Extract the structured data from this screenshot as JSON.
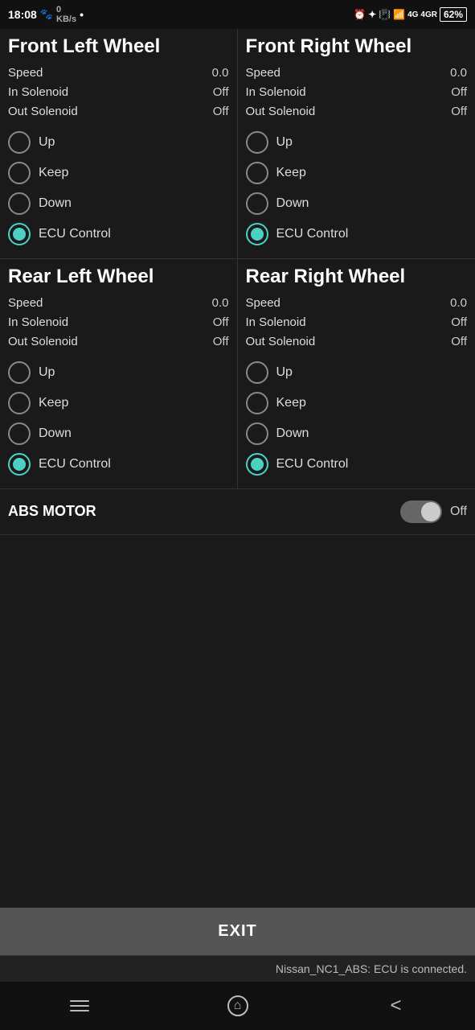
{
  "statusBar": {
    "time": "18:08",
    "battery": "62"
  },
  "wheels": [
    {
      "id": "front-left",
      "title": "Front Left Wheel",
      "speed_label": "Speed",
      "speed_value": "0.0",
      "in_solenoid_label": "In Solenoid",
      "in_solenoid_value": "Off",
      "out_solenoid_label": "Out Solenoid",
      "out_solenoid_value": "Off",
      "options": [
        "Up",
        "Keep",
        "Down",
        "ECU Control"
      ],
      "selected": 3
    },
    {
      "id": "front-right",
      "title": "Front Right Wheel",
      "speed_label": "Speed",
      "speed_value": "0.0",
      "in_solenoid_label": "In Solenoid",
      "in_solenoid_value": "Off",
      "out_solenoid_label": "Out Solenoid",
      "out_solenoid_value": "Off",
      "options": [
        "Up",
        "Keep",
        "Down",
        "ECU Control"
      ],
      "selected": 3
    },
    {
      "id": "rear-left",
      "title": "Rear Left Wheel",
      "speed_label": "Speed",
      "speed_value": "0.0",
      "in_solenoid_label": "In Solenoid",
      "in_solenoid_value": "Off",
      "out_solenoid_label": "Out Solenoid",
      "out_solenoid_value": "Off",
      "options": [
        "Up",
        "Keep",
        "Down",
        "ECU Control"
      ],
      "selected": 3
    },
    {
      "id": "rear-right",
      "title": "Rear Right Wheel",
      "speed_label": "Speed",
      "speed_value": "0.0",
      "in_solenoid_label": "In Solenoid",
      "in_solenoid_value": "Off",
      "out_solenoid_label": "Out Solenoid",
      "out_solenoid_value": "Off",
      "options": [
        "Up",
        "Keep",
        "Down",
        "ECU Control"
      ],
      "selected": 3
    }
  ],
  "absMotor": {
    "label": "ABS MOTOR",
    "value": "Off",
    "enabled": false
  },
  "exitButton": {
    "label": "EXIT"
  },
  "connectionStatus": {
    "text": "Nissan_NC1_ABS: ECU is connected."
  }
}
